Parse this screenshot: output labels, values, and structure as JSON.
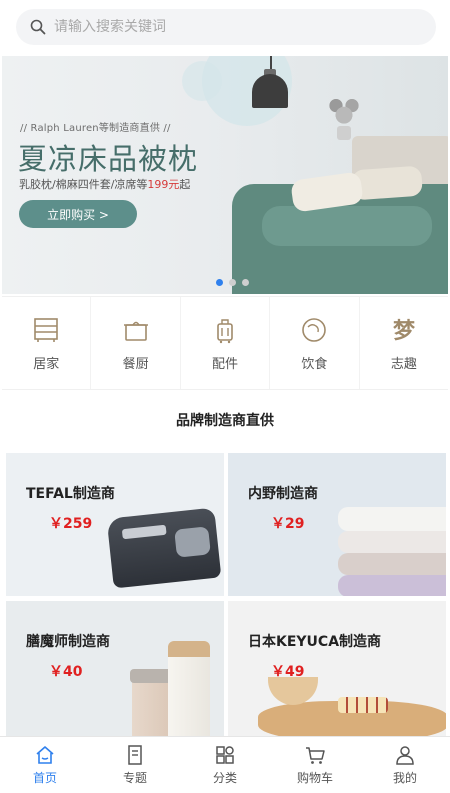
{
  "search": {
    "placeholder": "请输入搜索关键词",
    "icon": "search-icon"
  },
  "banner": {
    "subtitle": "// Ralph Lauren等制造商直供 //",
    "title": "夏凉床品被枕",
    "desc_prefix": "乳胶枕/棉麻四件套/凉席等",
    "desc_price": "199元",
    "desc_suffix": "起",
    "cta_label": "立即购买 >",
    "dot_count": 3,
    "active_dot": 0
  },
  "categories": [
    {
      "label": "居家",
      "icon": "cabinet-icon"
    },
    {
      "label": "餐厨",
      "icon": "pot-icon"
    },
    {
      "label": "配件",
      "icon": "luggage-icon"
    },
    {
      "label": "饮食",
      "icon": "food-icon"
    },
    {
      "label": "志趣",
      "icon": "interest-icon"
    }
  ],
  "section_title": "品牌制造商直供",
  "products": [
    {
      "name": "TEFAL制造商",
      "price": "￥259"
    },
    {
      "name": "内野制造商",
      "price": "￥29"
    },
    {
      "name": "膳魔师制造商",
      "price": "￥40"
    },
    {
      "name": "日本KEYUCA制造商",
      "price": "￥49"
    }
  ],
  "tabbar": {
    "items": [
      {
        "label": "首页",
        "icon": "home-icon",
        "active": true
      },
      {
        "label": "专题",
        "icon": "topic-icon",
        "active": false
      },
      {
        "label": "分类",
        "icon": "category-icon",
        "active": false
      },
      {
        "label": "购物车",
        "icon": "cart-icon",
        "active": false
      },
      {
        "label": "我的",
        "icon": "user-icon",
        "active": false
      }
    ]
  },
  "colors": {
    "accent": "#2f80ed",
    "price": "#e02020",
    "banner_title": "#466e6a",
    "cta": "#5d8f8b",
    "icon": "#a08a6a"
  }
}
